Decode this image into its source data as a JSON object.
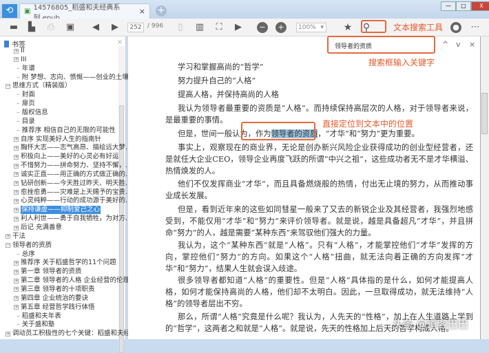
{
  "tab": {
    "title": "14576805_稻盛和夫经典系列.epub",
    "close": "×",
    "new": "+"
  },
  "window": {
    "min": "—",
    "max": "□",
    "close": "X"
  },
  "toolbar": {
    "page_current": "252",
    "page_total": "/ 996",
    "zoom": "100%"
  },
  "annotations": {
    "search_tool": "文本搜索工具",
    "search_input": "搜索框输入关键字",
    "locate": "直接定位到文本中的位置"
  },
  "search": {
    "value": "领导者的资质",
    "prev": "^",
    "next": "v",
    "close": "×"
  },
  "sidebar": {
    "title": "书签",
    "close": "×",
    "items": [
      {
        "label": "II",
        "level": 1,
        "exp": "+"
      },
      {
        "label": "III",
        "level": 1,
        "exp": "+"
      },
      {
        "label": "年谱",
        "level": 1
      },
      {
        "label": "附 梦想、志向、愤慨——创业的土壤",
        "level": 1
      },
      {
        "label": "思维方式（精装版）",
        "level": 0,
        "exp": "−"
      },
      {
        "label": "封面",
        "level": 1
      },
      {
        "label": "扉页",
        "level": 1
      },
      {
        "label": "版权信息",
        "level": 1
      },
      {
        "label": "目录",
        "level": 1
      },
      {
        "label": "推荐序 相信自己的无限的可能性",
        "level": 1
      },
      {
        "label": "自序 实现美好人生的指南针",
        "level": 1,
        "exp": "+"
      },
      {
        "label": "胸怀大志——志气高昂、描绘远大梦...",
        "level": 1,
        "exp": "+"
      },
      {
        "label": "积极向上——美好的心灵必有好运",
        "level": 1,
        "exp": "+"
      },
      {
        "label": "不惜努力——拼命努力、坚持不懈，...",
        "level": 1,
        "exp": "+"
      },
      {
        "label": "诚实正直——用正确的方式做正确的...",
        "level": 1,
        "exp": "+"
      },
      {
        "label": "钻研创新——今天胜过昨天、明天胜...",
        "level": 1,
        "exp": "+"
      },
      {
        "label": "愈挫愈勇——灾难是上天赐予的宝贵...",
        "level": 1,
        "exp": "+"
      },
      {
        "label": "心灵纯粹——行动的成功源于美好的...",
        "level": 1,
        "exp": "+"
      },
      {
        "label": "保持谦虚——抑制爱己之心",
        "level": 1,
        "exp": "+",
        "selected": true
      },
      {
        "label": "利人利世——勇于自我牺牲，为对方...",
        "level": 1,
        "exp": "+"
      },
      {
        "label": "后记 充满善意",
        "level": 1,
        "exp": "+"
      },
      {
        "label": "干法",
        "level": 0,
        "exp": "+"
      },
      {
        "label": "领导者的资质",
        "level": 0,
        "exp": "−"
      },
      {
        "label": "总序",
        "level": 1
      },
      {
        "label": "推荐序 关于稻盛哲学的11个问题",
        "level": 1,
        "exp": "+"
      },
      {
        "label": "第一章 领导者的资质",
        "level": 1,
        "exp": "+"
      },
      {
        "label": "第二章 领导者的人格 企业经营的伦理",
        "level": 1,
        "exp": "+"
      },
      {
        "label": "第三章 领导者的十项职责",
        "level": 1,
        "exp": "+"
      },
      {
        "label": "第四章 企业统治的要诀",
        "level": 1,
        "exp": "+"
      },
      {
        "label": "第五章 经营哲学践行体悟",
        "level": 1,
        "exp": "+"
      },
      {
        "label": "稻盛和夫年表",
        "level": 1
      },
      {
        "label": "关于盛和塾",
        "level": 1
      },
      {
        "label": "调动员工积极性的七个关键：稻盛和夫经...",
        "level": 0,
        "exp": "+"
      }
    ]
  },
  "content": {
    "p1": "学习和掌握高尚的“哲学”",
    "p2": "努力提升自己的“人格”",
    "p3": "提高人格，并保持高尚的人格",
    "p4": "我认为领导者最重要的资质是“人格”。而持续保持高层次的人格，对于领导者来说，是最重要的事情。",
    "p5a": "但是，世间一般认为，作为",
    "p5hl": "领导者的资质",
    "p5b": "，“才华”和“努力”更为重要。",
    "p6": "事实上，观察现在的商业界，无论是创办新兴风险企业获得成功的创业型经营者，还是就任大企业CEO，领导企业再度飞跃的所谓“中兴之祖”，这些成功者无不是才华横溢、热情焕发的人。",
    "p7": "他们不仅发挥商业“才华”，而且具备燃烧般的热情，付出无止境的努力，从而推动事业成长发展。",
    "p8": "但是，看到近年来的这些如同彗星一般来了又去的新锐企业及其经营者，我强烈地感受到，不能仅用“才华”和“努力”来评价领导者。就是说，越是具备超凡“才华”，并且拼命“努力”的人，越是需要“某种东西”来驾驭他们强大的力量。",
    "p9": "我认为，这个“某种东西”就是“人格”。只有“人格”，才能掌控他们“才华”发挥的方向，掌控他们“努力”的方向。如果这个“人格”扭曲，就无法向着正确的方向发挥“才华”和“努力”，结果人生就会误入歧途。",
    "p10": "很多领导者都知道“人格”的重要性。但是“人格”具体指的是什么，如何才能提高人格，如何才能保持高尚的人格，他们却不太明白。因此，一旦取得成功，就无法维持“人格”的领导者层出不穷。",
    "p11": "那么，所谓“人格”究竟是什么呢？我认为，人先天的“性格”，加上在人生道路上学到的“哲学”，这两者之和就是“人格”。就是说，先天的性格加上后天的哲学构成人格。"
  },
  "watermark": "头条 @道客巴巴"
}
